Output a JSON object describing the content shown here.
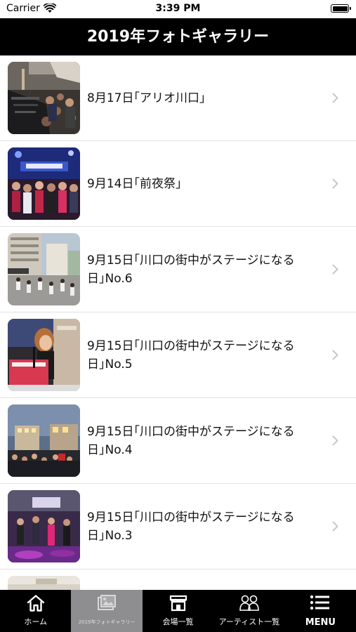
{
  "status_bar": {
    "carrier": "Carrier",
    "time": "3:39 PM"
  },
  "nav": {
    "title": "2019年フォトギャラリー"
  },
  "gallery": [
    {
      "label": "8月17日｢アリオ川口｣",
      "thumbnail": "mixing-console-crowd-photo"
    },
    {
      "label": "9月14日｢前夜祭｣",
      "thumbnail": "night-stage-performers-photo"
    },
    {
      "label": "9月15日｢川口の街中がステージになる日｣No.6",
      "thumbnail": "street-dance-parade-photo"
    },
    {
      "label": "9月15日｢川口の街中がステージになる日｣No.5",
      "thumbnail": "singer-at-keyboard-photo"
    },
    {
      "label": "9月15日｢川口の街中がステージになる日｣No.4",
      "thumbnail": "evening-plaza-stage-photo"
    },
    {
      "label": "9月15日｢川口の街中がステージになる日｣No.3",
      "thumbnail": "band-on-stage-photo"
    },
    {
      "label": "",
      "thumbnail": "partial-photo"
    }
  ],
  "tabs": [
    {
      "label": "ホーム",
      "icon": "home-icon",
      "active": false
    },
    {
      "label": "2019年フォトギャラリー",
      "icon": "photo-gallery-icon",
      "active": true
    },
    {
      "label": "会場一覧",
      "icon": "venue-icon",
      "active": false
    },
    {
      "label": "アーティスト一覧",
      "icon": "artists-icon",
      "active": false
    },
    {
      "label": "MENU",
      "icon": "hamburger-menu-icon",
      "active": false
    }
  ],
  "colors": {
    "nav_background": "#000000",
    "tab_active": "#8e8e90",
    "separator": "#e2e2e4",
    "chevron": "#c7c7cc"
  }
}
